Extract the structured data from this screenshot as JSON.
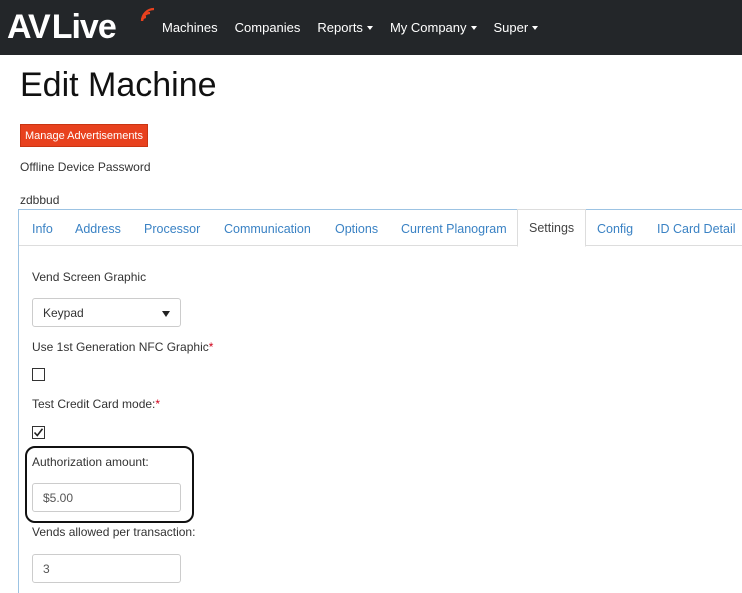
{
  "brand": {
    "name_left": "AV",
    "name_right": "Live"
  },
  "nav": {
    "items": [
      {
        "label": "Machines",
        "dropdown": false
      },
      {
        "label": "Companies",
        "dropdown": false
      },
      {
        "label": "Reports",
        "dropdown": true
      },
      {
        "label": "My Company",
        "dropdown": true
      },
      {
        "label": "Super",
        "dropdown": true
      }
    ]
  },
  "page": {
    "title": "Edit Machine",
    "manage_ads_label": "Manage Advertisements",
    "offline_password_label": "Offline Device Password",
    "offline_password_value": "zdbbud"
  },
  "tabs": [
    {
      "label": "Info",
      "active": false
    },
    {
      "label": "Address",
      "active": false
    },
    {
      "label": "Processor",
      "active": false
    },
    {
      "label": "Communication",
      "active": false
    },
    {
      "label": "Options",
      "active": false
    },
    {
      "label": "Current Planogram",
      "active": false
    },
    {
      "label": "Settings",
      "active": true
    },
    {
      "label": "Config",
      "active": false
    },
    {
      "label": "ID Card Detail",
      "active": false
    }
  ],
  "settings": {
    "vend_screen_label": "Vend Screen Graphic",
    "vend_screen_value": "Keypad",
    "nfc_label": "Use 1st Generation NFC Graphic",
    "nfc_checked": false,
    "test_cc_label": "Test Credit Card mode:",
    "test_cc_checked": true,
    "required_mark": "*",
    "auth_amount_label": "Authorization amount:",
    "auth_amount_value": "$5.00",
    "vends_allowed_label": "Vends allowed per transaction:",
    "vends_allowed_value": "3"
  },
  "colors": {
    "navbar_bg": "#232629",
    "accent_red": "#e8411e",
    "link_blue": "#3a82c4",
    "required_red": "#d0021b"
  }
}
